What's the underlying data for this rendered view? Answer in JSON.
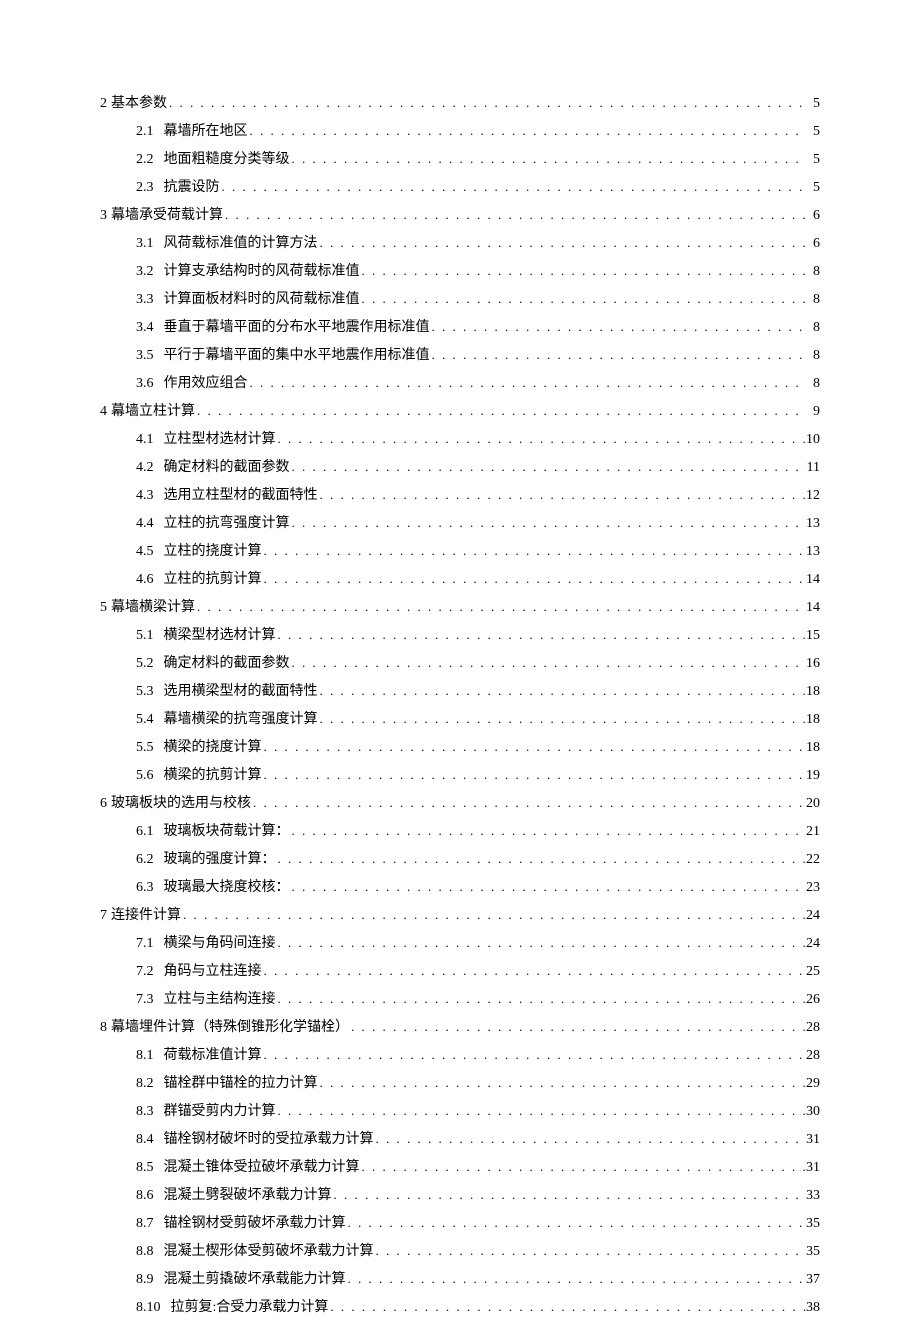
{
  "toc_entries": [
    {
      "level": 1,
      "num": "2",
      "title": "基本参数",
      "page": "5"
    },
    {
      "level": 2,
      "num": "2.1",
      "title": "幕墙所在地区",
      "page": "5"
    },
    {
      "level": 2,
      "num": "2.2",
      "title": "地面粗糙度分类等级",
      "page": "5"
    },
    {
      "level": 2,
      "num": "2.3",
      "title": "抗震设防",
      "page": "5"
    },
    {
      "level": 1,
      "num": "3",
      "title": "幕墙承受荷载计算",
      "page": "6"
    },
    {
      "level": 2,
      "num": "3.1",
      "title": "风荷载标准值的计算方法",
      "page": "6"
    },
    {
      "level": 2,
      "num": "3.2",
      "title": "计算支承结构时的风荷载标准值",
      "page": "8"
    },
    {
      "level": 2,
      "num": "3.3",
      "title": "计算面板材料时的风荷载标准值",
      "page": "8"
    },
    {
      "level": 2,
      "num": "3.4",
      "title": "垂直于幕墙平面的分布水平地震作用标准值",
      "page": "8"
    },
    {
      "level": 2,
      "num": "3.5",
      "title": "平行于幕墙平面的集中水平地震作用标准值",
      "page": "8"
    },
    {
      "level": 2,
      "num": "3.6",
      "title": "作用效应组合",
      "page": "8"
    },
    {
      "level": 1,
      "num": "4",
      "title": "幕墙立柱计算",
      "page": "9"
    },
    {
      "level": 2,
      "num": "4.1",
      "title": "立柱型材选材计算",
      "page": "10"
    },
    {
      "level": 2,
      "num": "4.2",
      "title": "确定材料的截面参数",
      "page": "11"
    },
    {
      "level": 2,
      "num": "4.3",
      "title": "选用立柱型材的截面特性",
      "page": "12"
    },
    {
      "level": 2,
      "num": "4.4",
      "title": "立柱的抗弯强度计算",
      "page": "13"
    },
    {
      "level": 2,
      "num": "4.5",
      "title": "立柱的挠度计算",
      "page": "13"
    },
    {
      "level": 2,
      "num": "4.6",
      "title": "立柱的抗剪计算",
      "page": "14"
    },
    {
      "level": 1,
      "num": "5",
      "title": "幕墙横梁计算",
      "page": "14"
    },
    {
      "level": 2,
      "num": "5.1",
      "title": "横梁型材选材计算",
      "page": "15"
    },
    {
      "level": 2,
      "num": "5.2",
      "title": "确定材料的截面参数",
      "page": "16"
    },
    {
      "level": 2,
      "num": "5.3",
      "title": "选用横梁型材的截面特性",
      "page": "18"
    },
    {
      "level": 2,
      "num": "5.4",
      "title": "幕墙横梁的抗弯强度计算",
      "page": "18"
    },
    {
      "level": 2,
      "num": "5.5",
      "title": "横梁的挠度计算",
      "page": "18"
    },
    {
      "level": 2,
      "num": "5.6",
      "title": "横梁的抗剪计算",
      "page": "19"
    },
    {
      "level": 1,
      "num": "6",
      "title": "玻璃板块的选用与校核",
      "page": "20"
    },
    {
      "level": 2,
      "num": "6.1",
      "title": "玻璃板块荷载计算：",
      "page": "21"
    },
    {
      "level": 2,
      "num": "6.2",
      "title": "玻璃的强度计算：",
      "page": "22"
    },
    {
      "level": 2,
      "num": "6.3",
      "title": "玻璃最大挠度校核：",
      "page": "23"
    },
    {
      "level": 1,
      "num": "7",
      "title": "连接件计算",
      "page": "24"
    },
    {
      "level": 2,
      "num": "7.1",
      "title": "横梁与角码间连接",
      "page": "24"
    },
    {
      "level": 2,
      "num": "7.2",
      "title": "角码与立柱连接",
      "page": "25"
    },
    {
      "level": 2,
      "num": "7.3",
      "title": "立柱与主结构连接",
      "page": "26"
    },
    {
      "level": 1,
      "num": "8",
      "title": "幕墙埋件计算（特殊倒锥形化学锚栓）",
      "page": "28"
    },
    {
      "level": 2,
      "num": "8.1",
      "title": "荷载标准值计算",
      "page": "28"
    },
    {
      "level": 2,
      "num": "8.2",
      "title": "锚栓群中锚栓的拉力计算",
      "page": "29"
    },
    {
      "level": 2,
      "num": "8.3",
      "title": "群锚受剪内力计算",
      "page": "30"
    },
    {
      "level": 2,
      "num": "8.4",
      "title": "锚栓钢材破坏时的受拉承载力计算",
      "page": "31"
    },
    {
      "level": 2,
      "num": "8.5",
      "title": "混凝土锥体受拉破坏承载力计算",
      "page": "31"
    },
    {
      "level": 2,
      "num": "8.6",
      "title": "混凝土劈裂破坏承载力计算",
      "page": "33"
    },
    {
      "level": 2,
      "num": "8.7",
      "title": "锚栓钢材受剪破坏承载力计算",
      "page": "35"
    },
    {
      "level": 2,
      "num": "8.8",
      "title": "混凝土楔形体受剪破坏承载力计算",
      "page": "35"
    },
    {
      "level": 2,
      "num": "8.9",
      "title": "混凝土剪撬破坏承载能力计算",
      "page": "37"
    },
    {
      "level": 2,
      "num": "8.10",
      "title": "拉剪复:合受力承载力计算",
      "page": "38"
    }
  ]
}
